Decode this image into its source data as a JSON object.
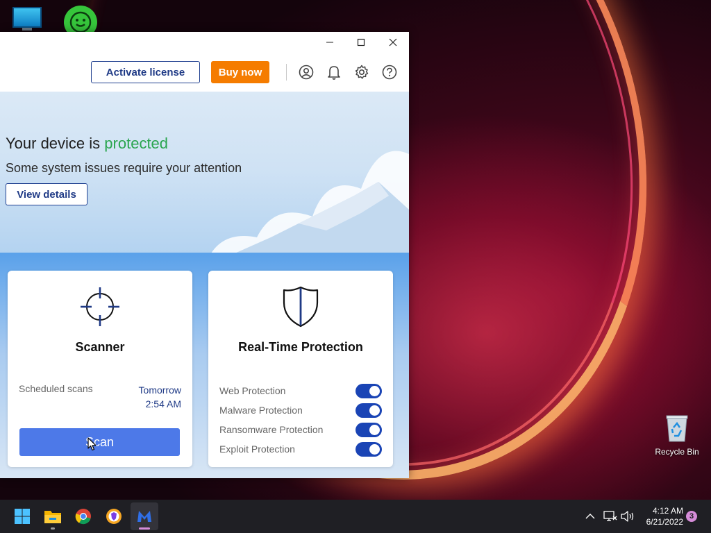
{
  "desktop": {
    "recycle_bin_label": "Recycle Bin"
  },
  "window": {
    "controls": {
      "minimize": "minimize",
      "maximize": "maximize",
      "close": "close"
    }
  },
  "header": {
    "activate_label": "Activate license",
    "buy_label": "Buy now",
    "icons": [
      "account-icon",
      "bell-icon",
      "gear-icon",
      "help-icon"
    ],
    "accent_color": "#f57c00",
    "brand_color": "#1f3a86"
  },
  "hero": {
    "title_prefix": "Your device is",
    "title_status": "protected",
    "status_color": "#2aa54f",
    "subtitle": "Some system issues require your attention",
    "view_details_label": "View details"
  },
  "scanner": {
    "title": "Scanner",
    "icon": "crosshair-icon",
    "scheduled_label": "Scheduled scans",
    "scheduled_day": "Tomorrow",
    "scheduled_time": "2:54 AM",
    "scan_label": "Scan",
    "scan_color": "#4d79e8"
  },
  "realtime": {
    "title": "Real-Time Protection",
    "icon": "shield-icon",
    "items": [
      {
        "label": "Web Protection",
        "enabled": true
      },
      {
        "label": "Malware Protection",
        "enabled": true
      },
      {
        "label": "Ransomware Protection",
        "enabled": true
      },
      {
        "label": "Exploit Protection",
        "enabled": true
      }
    ],
    "toggle_color": "#1a44b5"
  },
  "taskbar": {
    "apps": [
      "windows-start-icon",
      "file-explorer-icon",
      "chrome-icon",
      "brave-icon",
      "malwarebytes-icon"
    ],
    "time": "4:12 AM",
    "date": "6/21/2022",
    "notification_count": "3"
  }
}
